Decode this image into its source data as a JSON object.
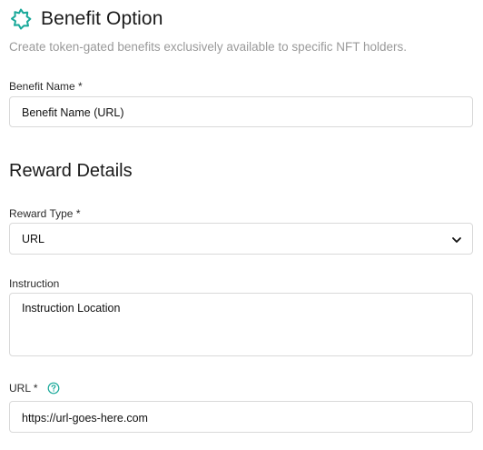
{
  "header": {
    "title": "Benefit Option",
    "subtitle": "Create token-gated benefits exclusively available to specific NFT holders."
  },
  "benefit_name": {
    "label": "Benefit Name *",
    "value": "Benefit Name (URL)"
  },
  "reward_details": {
    "title": "Reward Details",
    "reward_type": {
      "label": "Reward Type *",
      "value": "URL"
    },
    "instruction": {
      "label": "Instruction",
      "value": "Instruction Location"
    },
    "url": {
      "label": "URL *",
      "value": "https://url-goes-here.com"
    }
  },
  "colors": {
    "accent": "#1aa99a",
    "border": "#d9d9d9",
    "subtle_text": "#9a9a9a"
  },
  "icons": {
    "header": "badge-star-icon",
    "help": "question-circle-icon",
    "dropdown": "chevron-down-icon"
  }
}
